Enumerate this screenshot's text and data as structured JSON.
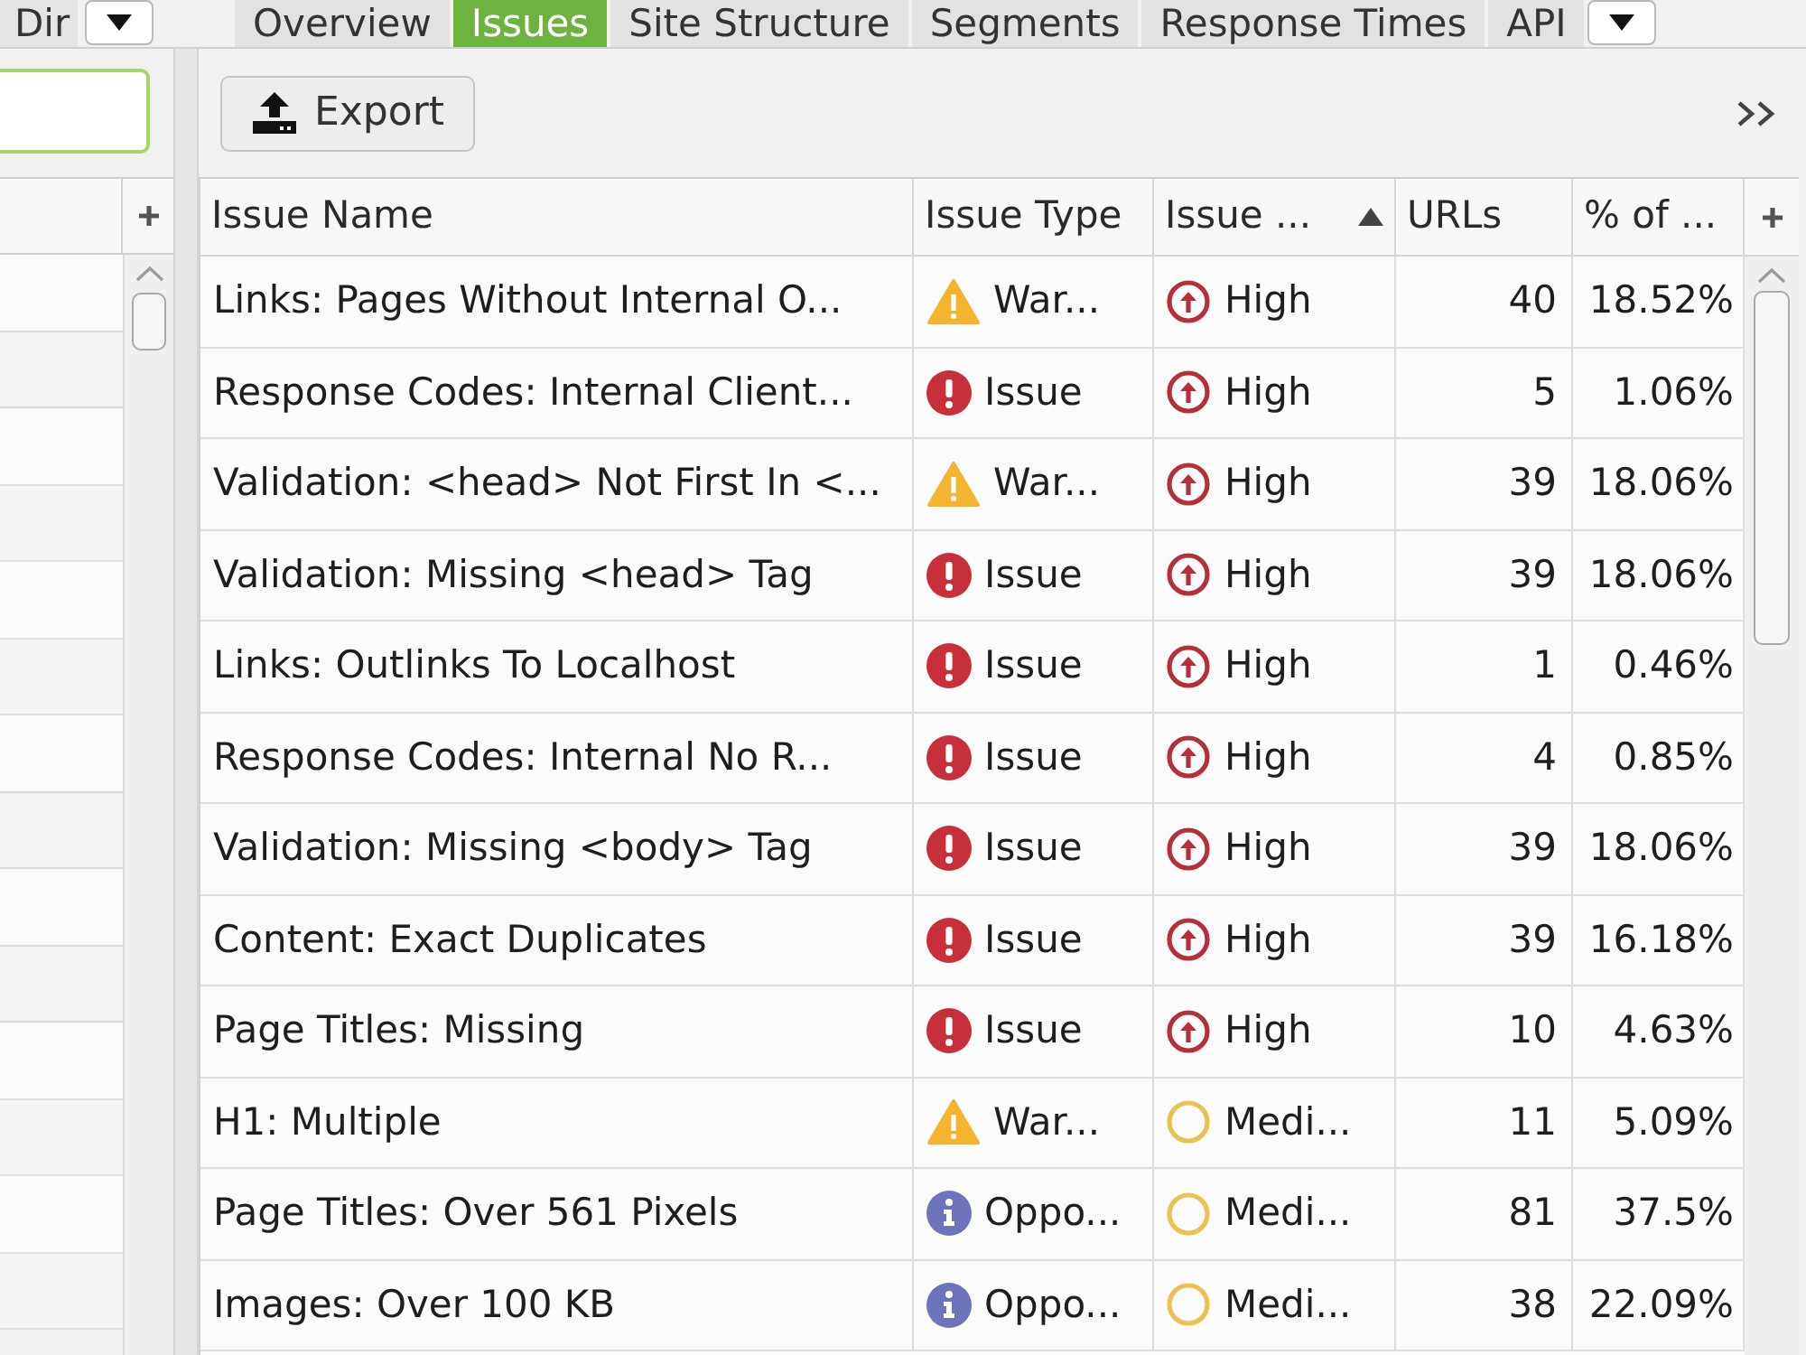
{
  "left_panel": {
    "tabs": [
      {
        "label": "Dir",
        "selected": false
      }
    ]
  },
  "tabs": [
    {
      "label": "Overview",
      "selected": false
    },
    {
      "label": "Issues",
      "selected": true
    },
    {
      "label": "Site Structure",
      "selected": false
    },
    {
      "label": "Segments",
      "selected": false
    },
    {
      "label": "Response Times",
      "selected": false
    },
    {
      "label": "API",
      "selected": false
    }
  ],
  "toolbar": {
    "export_button": "Export"
  },
  "table": {
    "columns": [
      {
        "label": "Issue Name",
        "sorted": false
      },
      {
        "label": "Issue Type",
        "sorted": false
      },
      {
        "label": "Issue ...",
        "sorted": true
      },
      {
        "label": "URLs",
        "sorted": false
      },
      {
        "label": "% of ...",
        "sorted": false
      }
    ],
    "rows": [
      {
        "issue_name": "Links: Pages Without Internal O...",
        "issue_type": {
          "kind": "warning",
          "label": "War..."
        },
        "priority": {
          "kind": "high",
          "label": "High"
        },
        "urls": "40",
        "percent": "18.52%"
      },
      {
        "issue_name": "Response Codes: Internal Client...",
        "issue_type": {
          "kind": "issue",
          "label": "Issue"
        },
        "priority": {
          "kind": "high",
          "label": "High"
        },
        "urls": "5",
        "percent": "1.06%"
      },
      {
        "issue_name": "Validation: <head> Not First In <...",
        "issue_type": {
          "kind": "warning",
          "label": "War..."
        },
        "priority": {
          "kind": "high",
          "label": "High"
        },
        "urls": "39",
        "percent": "18.06%"
      },
      {
        "issue_name": "Validation: Missing <head> Tag",
        "issue_type": {
          "kind": "issue",
          "label": "Issue"
        },
        "priority": {
          "kind": "high",
          "label": "High"
        },
        "urls": "39",
        "percent": "18.06%"
      },
      {
        "issue_name": "Links: Outlinks To Localhost",
        "issue_type": {
          "kind": "issue",
          "label": "Issue"
        },
        "priority": {
          "kind": "high",
          "label": "High"
        },
        "urls": "1",
        "percent": "0.46%"
      },
      {
        "issue_name": "Response Codes: Internal No R...",
        "issue_type": {
          "kind": "issue",
          "label": "Issue"
        },
        "priority": {
          "kind": "high",
          "label": "High"
        },
        "urls": "4",
        "percent": "0.85%"
      },
      {
        "issue_name": "Validation: Missing <body> Tag",
        "issue_type": {
          "kind": "issue",
          "label": "Issue"
        },
        "priority": {
          "kind": "high",
          "label": "High"
        },
        "urls": "39",
        "percent": "18.06%"
      },
      {
        "issue_name": "Content: Exact Duplicates",
        "issue_type": {
          "kind": "issue",
          "label": "Issue"
        },
        "priority": {
          "kind": "high",
          "label": "High"
        },
        "urls": "39",
        "percent": "16.18%"
      },
      {
        "issue_name": "Page Titles: Missing",
        "issue_type": {
          "kind": "issue",
          "label": "Issue"
        },
        "priority": {
          "kind": "high",
          "label": "High"
        },
        "urls": "10",
        "percent": "4.63%"
      },
      {
        "issue_name": "H1: Multiple",
        "issue_type": {
          "kind": "warning",
          "label": "War..."
        },
        "priority": {
          "kind": "medium",
          "label": "Medi..."
        },
        "urls": "11",
        "percent": "5.09%"
      },
      {
        "issue_name": "Page Titles: Over 561 Pixels",
        "issue_type": {
          "kind": "opportunity",
          "label": "Oppo..."
        },
        "priority": {
          "kind": "medium",
          "label": "Medi..."
        },
        "urls": "81",
        "percent": "37.5%"
      },
      {
        "issue_name": "Images: Over 100 KB",
        "issue_type": {
          "kind": "opportunity",
          "label": "Oppo..."
        },
        "priority": {
          "kind": "medium",
          "label": "Medi..."
        },
        "urls": "38",
        "percent": "22.09%"
      }
    ]
  }
}
